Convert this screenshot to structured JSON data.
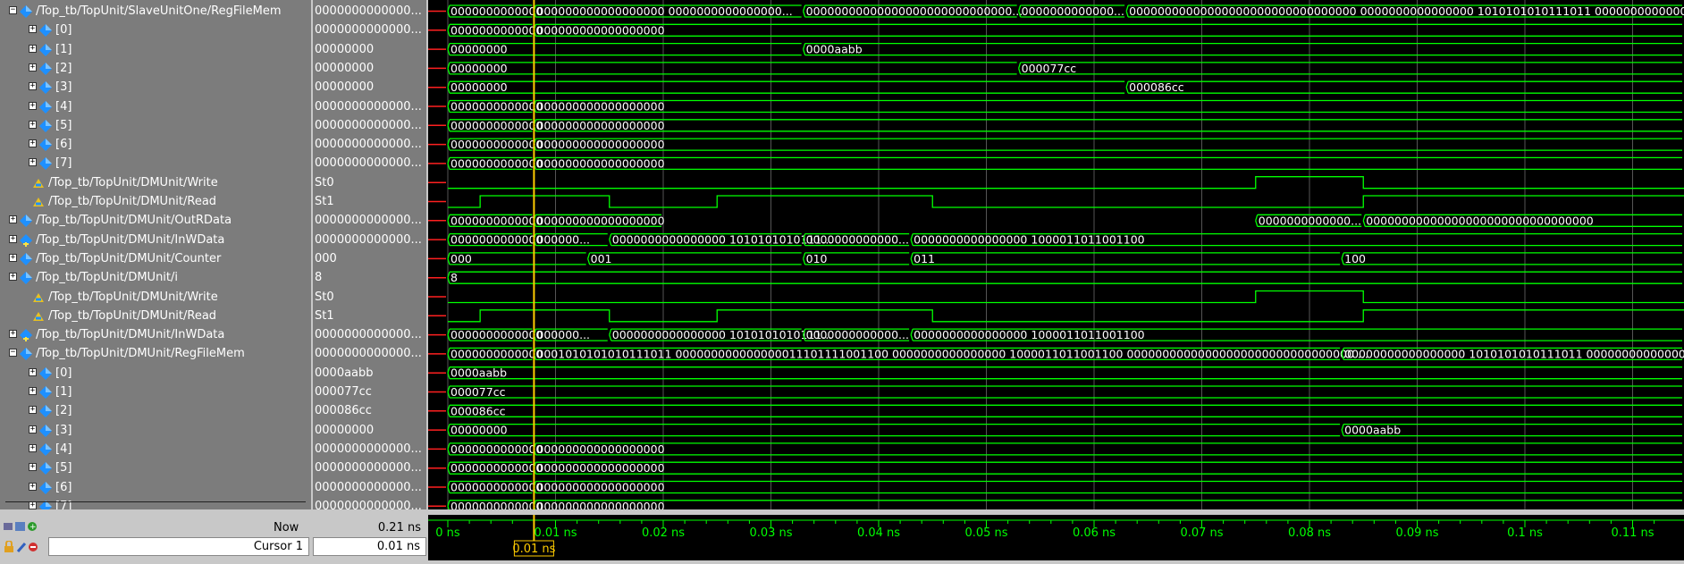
{
  "signals": [
    {
      "name": "/Top_tb/TopUnit/SlaveUnitOne/RegFileMem",
      "value": "0000000000000...",
      "indent": 0,
      "expand": "-",
      "icon": "diamond"
    },
    {
      "name": "[0]",
      "value": "0000000000000...",
      "indent": 2,
      "expand": "+",
      "icon": "diamond"
    },
    {
      "name": "[1]",
      "value": "00000000",
      "indent": 2,
      "expand": "+",
      "icon": "diamond"
    },
    {
      "name": "[2]",
      "value": "00000000",
      "indent": 2,
      "expand": "+",
      "icon": "diamond"
    },
    {
      "name": "[3]",
      "value": "00000000",
      "indent": 2,
      "expand": "+",
      "icon": "diamond"
    },
    {
      "name": "[4]",
      "value": "0000000000000...",
      "indent": 2,
      "expand": "+",
      "icon": "diamond"
    },
    {
      "name": "[5]",
      "value": "0000000000000...",
      "indent": 2,
      "expand": "+",
      "icon": "diamond"
    },
    {
      "name": "[6]",
      "value": "0000000000000...",
      "indent": 2,
      "expand": "+",
      "icon": "diamond"
    },
    {
      "name": "[7]",
      "value": "0000000000000...",
      "indent": 2,
      "expand": "+",
      "icon": "diamond"
    },
    {
      "name": "/Top_tb/TopUnit/DMUnit/Write",
      "value": "St0",
      "indent": 1,
      "expand": "",
      "icon": "logic"
    },
    {
      "name": "/Top_tb/TopUnit/DMUnit/Read",
      "value": "St1",
      "indent": 1,
      "expand": "",
      "icon": "logic"
    },
    {
      "name": "/Top_tb/TopUnit/DMUnit/OutRData",
      "value": "0000000000000...",
      "indent": 0,
      "expand": "+",
      "icon": "diamond"
    },
    {
      "name": "/Top_tb/TopUnit/DMUnit/InWData",
      "value": "0000000000000...",
      "indent": 0,
      "expand": "+",
      "icon": "input"
    },
    {
      "name": "/Top_tb/TopUnit/DMUnit/Counter",
      "value": "000",
      "indent": 0,
      "expand": "+",
      "icon": "diamond"
    },
    {
      "name": "/Top_tb/TopUnit/DMUnit/i",
      "value": "8",
      "indent": 0,
      "expand": "+",
      "icon": "diamond"
    },
    {
      "name": "/Top_tb/TopUnit/DMUnit/Write",
      "value": "St0",
      "indent": 1,
      "expand": "",
      "icon": "logic"
    },
    {
      "name": "/Top_tb/TopUnit/DMUnit/Read",
      "value": "St1",
      "indent": 1,
      "expand": "",
      "icon": "logic"
    },
    {
      "name": "/Top_tb/TopUnit/DMUnit/InWData",
      "value": "0000000000000...",
      "indent": 0,
      "expand": "+",
      "icon": "input"
    },
    {
      "name": "/Top_tb/TopUnit/DMUnit/RegFileMem",
      "value": "0000000000000...",
      "indent": 0,
      "expand": "-",
      "icon": "diamond"
    },
    {
      "name": "[0]",
      "value": "0000aabb",
      "indent": 2,
      "expand": "+",
      "icon": "diamond"
    },
    {
      "name": "[1]",
      "value": "000077cc",
      "indent": 2,
      "expand": "+",
      "icon": "diamond"
    },
    {
      "name": "[2]",
      "value": "000086cc",
      "indent": 2,
      "expand": "+",
      "icon": "diamond"
    },
    {
      "name": "[3]",
      "value": "00000000",
      "indent": 2,
      "expand": "+",
      "icon": "diamond"
    },
    {
      "name": "[4]",
      "value": "0000000000000...",
      "indent": 2,
      "expand": "+",
      "icon": "diamond"
    },
    {
      "name": "[5]",
      "value": "0000000000000...",
      "indent": 2,
      "expand": "+",
      "icon": "diamond"
    },
    {
      "name": "[6]",
      "value": "0000000000000...",
      "indent": 2,
      "expand": "+",
      "icon": "diamond"
    },
    {
      "name": "[7]",
      "value": "0000000000000...",
      "indent": 2,
      "expand": "+",
      "icon": "diamond"
    }
  ],
  "waves": [
    {
      "kind": "bus",
      "segs": [
        [
          0,
          0.008,
          "0000000000000"
        ],
        [
          0.008,
          0.033,
          "000000000000000000 0000000000000000..."
        ],
        [
          0.033,
          0.053,
          "00000000000000000000000000000..."
        ],
        [
          0.053,
          0.063,
          "0000000000000..."
        ],
        [
          0.063,
          0.113,
          "00000000000000000000000000000000 0000000000000000 1010101010111011 00000000000000..."
        ]
      ]
    },
    {
      "kind": "bus",
      "segs": [
        [
          0,
          0.008,
          "0000000000000"
        ],
        [
          0.008,
          0.02,
          "000000000000000000"
        ]
      ]
    },
    {
      "kind": "bus",
      "segs": [
        [
          0,
          0.033,
          "00000000"
        ],
        [
          0.033,
          0.113,
          "0000aabb"
        ]
      ]
    },
    {
      "kind": "bus",
      "segs": [
        [
          0,
          0.053,
          "00000000"
        ],
        [
          0.053,
          0.113,
          "000077cc"
        ]
      ]
    },
    {
      "kind": "bus",
      "segs": [
        [
          0,
          0.063,
          "00000000"
        ],
        [
          0.063,
          0.113,
          "000086cc"
        ]
      ]
    },
    {
      "kind": "bus",
      "segs": [
        [
          0,
          0.008,
          "0000000000000"
        ],
        [
          0.008,
          0.02,
          "000000000000000000"
        ]
      ]
    },
    {
      "kind": "bus",
      "segs": [
        [
          0,
          0.008,
          "0000000000000"
        ],
        [
          0.008,
          0.02,
          "000000000000000000"
        ]
      ]
    },
    {
      "kind": "bus",
      "segs": [
        [
          0,
          0.008,
          "0000000000000"
        ],
        [
          0.008,
          0.02,
          "000000000000000000"
        ]
      ]
    },
    {
      "kind": "bus",
      "segs": [
        [
          0,
          0.008,
          "0000000000000"
        ],
        [
          0.008,
          0.02,
          "000000000000000000"
        ]
      ]
    },
    {
      "kind": "logic",
      "init": "Z",
      "edges": [
        [
          0,
          0
        ],
        [
          0.075,
          1
        ],
        [
          0.085,
          0
        ]
      ]
    },
    {
      "kind": "logic",
      "init": "Z",
      "edges": [
        [
          0,
          0
        ],
        [
          0.003,
          1
        ],
        [
          0.015,
          0
        ],
        [
          0.025,
          1
        ],
        [
          0.045,
          0
        ],
        [
          0.085,
          1
        ]
      ]
    },
    {
      "kind": "bus",
      "segs": [
        [
          0,
          0.008,
          "0000000000000"
        ],
        [
          0.008,
          0.02,
          "000000000000000000"
        ],
        [
          0.075,
          0.085,
          "0000000000000..."
        ],
        [
          0.085,
          0.113,
          "00000000000000000000000000000000"
        ]
      ]
    },
    {
      "kind": "bus",
      "segs": [
        [
          0,
          0.008,
          "0000000000000"
        ],
        [
          0.008,
          0.015,
          "000000..."
        ],
        [
          0.015,
          0.033,
          "0000000000000000 1010101010111..."
        ],
        [
          0.033,
          0.043,
          "0000000000000..."
        ],
        [
          0.043,
          0.113,
          "0000000000000000 1000011011001100"
        ]
      ]
    },
    {
      "kind": "bus",
      "segs": [
        [
          0,
          0.013,
          "000"
        ],
        [
          0.013,
          0.033,
          "001"
        ],
        [
          0.033,
          0.043,
          "010"
        ],
        [
          0.043,
          0.083,
          "011"
        ],
        [
          0.083,
          0.113,
          "100"
        ]
      ]
    },
    {
      "kind": "bus",
      "segs": [
        [
          0,
          0.113,
          "8"
        ]
      ]
    },
    {
      "kind": "logic",
      "init": "Z",
      "edges": [
        [
          0,
          0
        ],
        [
          0.075,
          1
        ],
        [
          0.085,
          0
        ]
      ]
    },
    {
      "kind": "logic",
      "init": "Z",
      "edges": [
        [
          0,
          0
        ],
        [
          0.003,
          1
        ],
        [
          0.015,
          0
        ],
        [
          0.025,
          1
        ],
        [
          0.045,
          0
        ],
        [
          0.085,
          1
        ]
      ]
    },
    {
      "kind": "bus",
      "segs": [
        [
          0,
          0.008,
          "0000000000000"
        ],
        [
          0.008,
          0.015,
          "000000..."
        ],
        [
          0.015,
          0.033,
          "0000000000000000 1010101010111..."
        ],
        [
          0.033,
          0.043,
          "0000000000000..."
        ],
        [
          0.043,
          0.113,
          "0000000000000000 1000011011001100"
        ]
      ]
    },
    {
      "kind": "bus",
      "segs": [
        [
          0,
          0.008,
          "0000000000000"
        ],
        [
          0.008,
          0.083,
          "0001010101010111011 000000000000000011101111001100 0000000000000000 1000011011001100 00000000000000000000000000000000 ..."
        ],
        [
          0.083,
          0.113,
          "00000000000000000 1010101010111011 00000000000000..."
        ]
      ]
    },
    {
      "kind": "bus",
      "segs": [
        [
          0,
          0.113,
          "0000aabb"
        ]
      ]
    },
    {
      "kind": "bus",
      "segs": [
        [
          0,
          0.113,
          "000077cc"
        ]
      ]
    },
    {
      "kind": "bus",
      "segs": [
        [
          0,
          0.113,
          "000086cc"
        ]
      ]
    },
    {
      "kind": "bus",
      "segs": [
        [
          0,
          0.083,
          "00000000"
        ],
        [
          0.083,
          0.113,
          "0000aabb"
        ]
      ]
    },
    {
      "kind": "bus",
      "segs": [
        [
          0,
          0.008,
          "0000000000000"
        ],
        [
          0.008,
          0.02,
          "000000000000000000"
        ]
      ]
    },
    {
      "kind": "bus",
      "segs": [
        [
          0,
          0.008,
          "0000000000000"
        ],
        [
          0.008,
          0.02,
          "000000000000000000"
        ]
      ]
    },
    {
      "kind": "bus",
      "segs": [
        [
          0,
          0.008,
          "0000000000000"
        ],
        [
          0.008,
          0.02,
          "000000000000000000"
        ]
      ]
    },
    {
      "kind": "bus",
      "segs": [
        [
          0,
          0.008,
          "0000000000000"
        ],
        [
          0.008,
          0.02,
          "000000000000000000"
        ]
      ]
    }
  ],
  "timeline": {
    "ticks": [
      "0 ns",
      "0.01 ns",
      "0.02 ns",
      "0.03 ns",
      "0.04 ns",
      "0.05 ns",
      "0.06 ns",
      "0.07 ns",
      "0.08 ns",
      "0.09 ns",
      "0.1 ns",
      "0.11 ns"
    ],
    "cursor_time": 0.008
  },
  "footer": {
    "now_label": "Now",
    "now_value": "0.21 ns",
    "cursor_label": "Cursor 1",
    "cursor_value": "0.01 ns",
    "cursor_flag": "0.01 ns"
  },
  "colors": {
    "wave": "#00ff00",
    "cursor": "#ffcc00",
    "undriven": "#ff2020",
    "text": "#ffffff",
    "panel": "#7c7c7c",
    "icon": "#1e90ff"
  }
}
